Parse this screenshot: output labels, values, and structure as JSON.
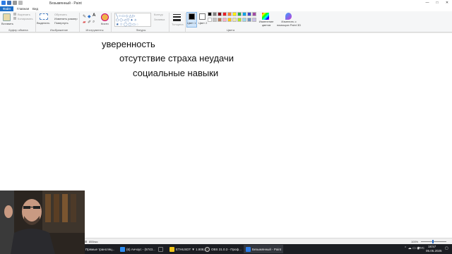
{
  "window": {
    "title": "Безымянный - Paint",
    "controls": [
      "—",
      "□",
      "✕"
    ]
  },
  "menu": {
    "file": "Файл",
    "home": "Главная",
    "view": "Вид"
  },
  "ribbon": {
    "clipboard": {
      "paste_label": "Вставить",
      "cut_label": "Вырезать",
      "copy_label": "Копировать",
      "group_label": "Буфер обмена"
    },
    "image": {
      "select_label": "Выделить",
      "crop_label": "Обрезать",
      "resize_label": "Изменить размер",
      "rotate_label": "Повернуть",
      "group_label": "Изображение"
    },
    "tools": {
      "group_label": "Инструменты",
      "brushes_label": "Кисти"
    },
    "shapes": {
      "outline_label": "Контур",
      "fill_label": "Заливка",
      "group_label": "Фигуры"
    },
    "size": {
      "label": "Толщина"
    },
    "colors": {
      "color1_label": "Цвет 1",
      "color2_label": "Цвет 2",
      "edit_label": "Изменение цветов",
      "paint3d_label": "Изменить с помощью Paint 3D",
      "group_label": "Цвета",
      "color1": "#000000",
      "color2": "#ffffff",
      "palette_row1": [
        "#000000",
        "#7f7f7f",
        "#880015",
        "#ed1c24",
        "#ff7f27",
        "#fff200",
        "#22b14c",
        "#00a2e8",
        "#3f48cc",
        "#a349a4"
      ],
      "palette_row2": [
        "#ffffff",
        "#c3c3c3",
        "#b97a57",
        "#ffaec9",
        "#ffc90e",
        "#efe4b0",
        "#b5e61d",
        "#99d9ea",
        "#7092be",
        "#c8bfe7"
      ]
    }
  },
  "canvas": {
    "lines": [
      "уверенность",
      "отсутствие страха неудачи",
      "социальные навыки"
    ]
  },
  "status": {
    "size_label": "855пкс",
    "zoom": "100%"
  },
  "taskbar": {
    "items": [
      "Прямые трансляц...",
      "(6) Анчоус - (5743...",
      "ETHUSDT ▼ 1.808,0...",
      "OBS 31.0.3 - Проф...",
      "Безымянный - Paint"
    ],
    "lang": "РУС",
    "time": "18:57",
    "date": "05.05.2025"
  }
}
